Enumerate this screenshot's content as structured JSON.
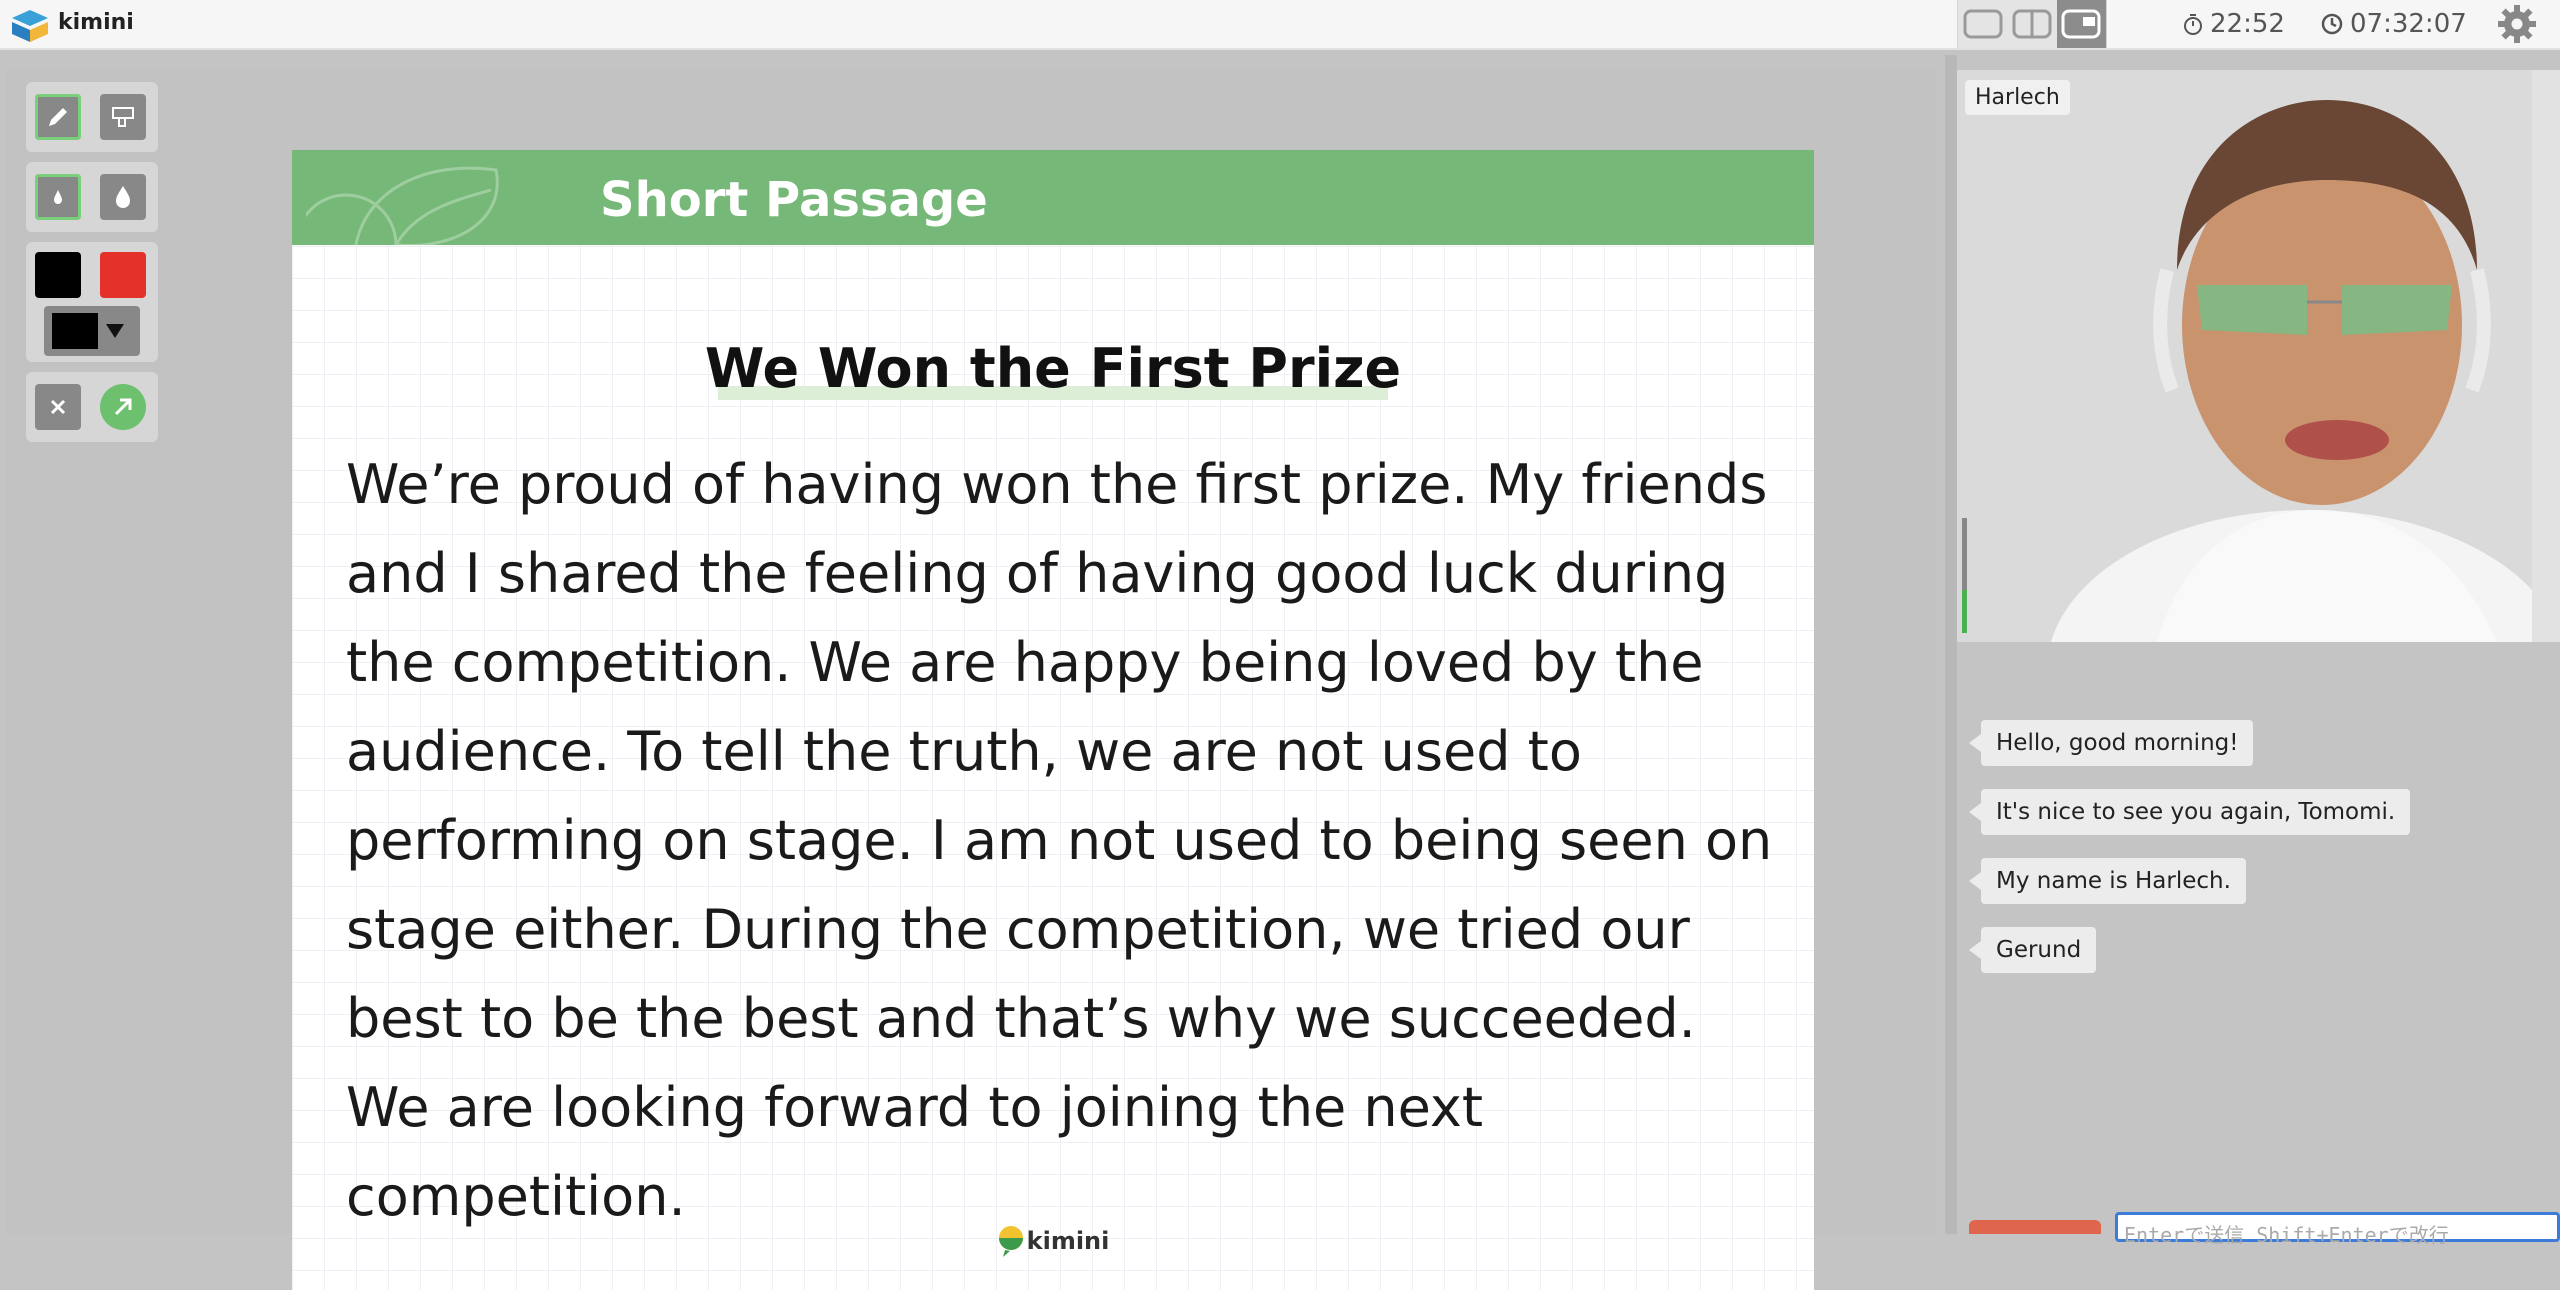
{
  "app": {
    "name": "kimini"
  },
  "header": {
    "timer": "22:52",
    "clock": "07:32:07"
  },
  "slide": {
    "header_title": "Short Passage",
    "title": "We Won the First Prize",
    "passage": [
      "We’re proud of having won the first prize. My friends",
      "and I shared the feeling of having good luck during",
      "the competition. We are happy being loved by the",
      "audience. To tell the truth, we are not used to",
      "performing on stage. I am not used to being seen on",
      "stage either. During the competition, we tried our",
      "best to be the best and that’s why we succeeded.",
      "We are looking forward to joining the next",
      "competition."
    ],
    "footer_brand": "kimini"
  },
  "colors": {
    "accent_green": "#76b878",
    "pen_black": "#000000",
    "pen_red": "#e4322b",
    "send_red": "#e0654d",
    "input_focus": "#3d7bd9"
  },
  "video": {
    "participant_name": "Harlech"
  },
  "chat": {
    "messages": [
      "Hello, good morning!",
      "It's nice to see you again, Tomomi.",
      "My name is Harlech.",
      "Gerund"
    ],
    "input_placeholder": "Enterで送信 Shift+Enterで改行"
  }
}
